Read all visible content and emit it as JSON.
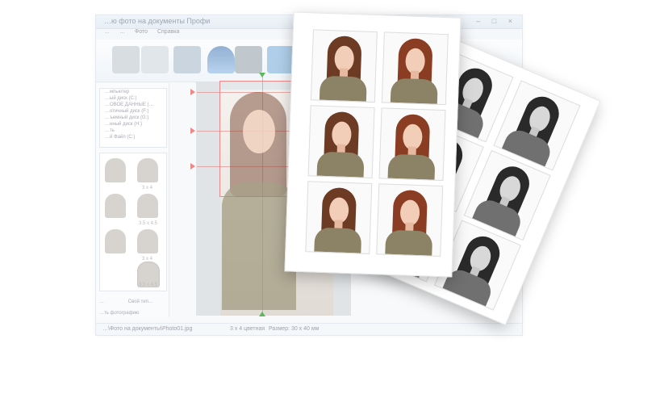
{
  "window": {
    "title": "…ю фото на документы Профи",
    "controls": "– □ ×"
  },
  "menu": [
    "…",
    "…",
    "Фото",
    "Справка"
  ],
  "tree_items": [
    "…мпьютер",
    "…ый диск (C:)",
    "…ОВОЕ ДАННЫЕ (…",
    "…отичный диск (F:)",
    "…ъемный диск (G:)",
    "…нный диск (H:)",
    "…ть",
    "…й Файл (C:)",
    "…ов (C:)"
  ],
  "thumb_labels": [
    "3 x 4",
    "3.5 x 4.5",
    "3 x 4",
    "3.5 x 4.5"
  ],
  "left_buttons": {
    "prev_label": "…",
    "own_label": "Свой тип…",
    "photo_label": "…ть фотографию"
  },
  "status": {
    "path": "…\\Фото на документы\\Photo01.jpg",
    "format": "3 x 4 цветная",
    "size": "Размер: 30 x 40 мм"
  },
  "colors": {
    "accent": "#3b6fb0",
    "hair": "#6d3a24",
    "crop_guide": "#e07b7b"
  },
  "icons": [
    "file-open-icon",
    "scanner-icon",
    "print-icon",
    "person-icon",
    "camera-icon",
    "slideshow-icon",
    "help-book-icon"
  ]
}
